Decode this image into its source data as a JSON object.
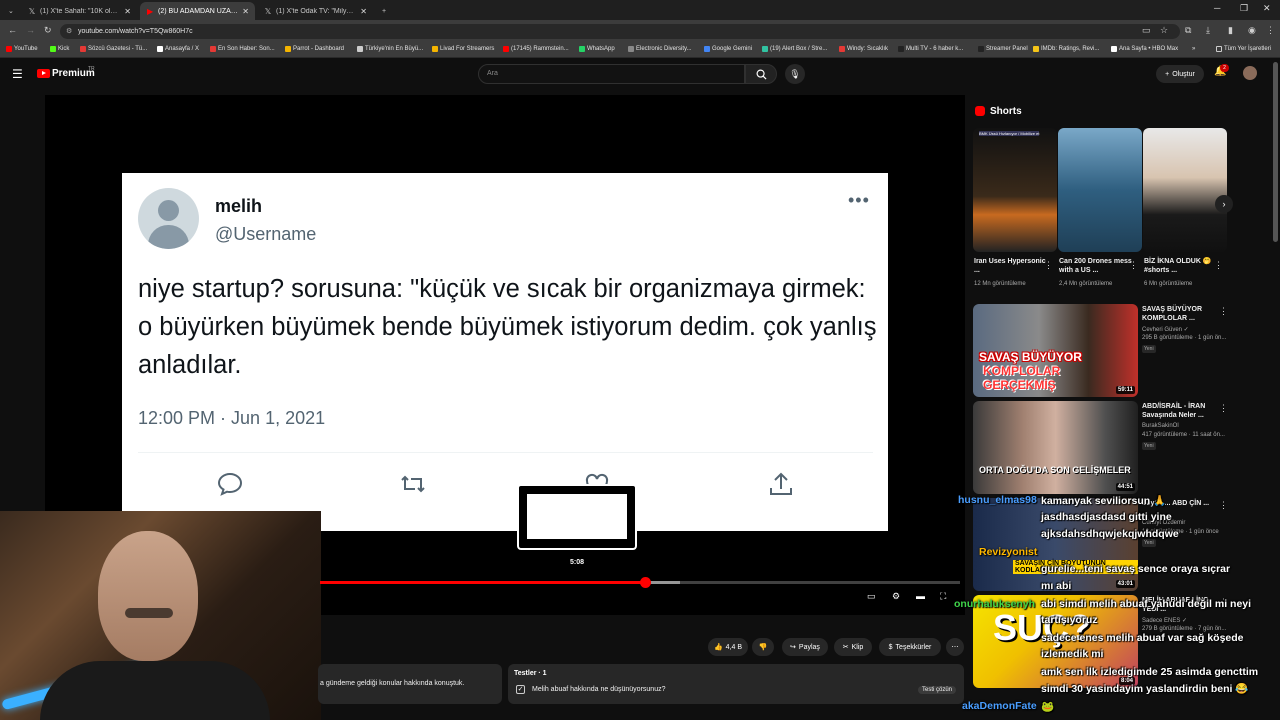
{
  "browser": {
    "tabs": [
      {
        "label": "(1) X'te Sahafi: \"10K olmuşuz. Bu...",
        "active": false
      },
      {
        "label": "(2) BU ADAMDAN UZAK DURUN",
        "active": true
      },
      {
        "label": "(1) X'te Odak TV: \"Milyonlarca (...",
        "active": false
      }
    ],
    "new_tab": "+",
    "url": "youtube.com/watch?v=T5Qw860H7c",
    "bookmarks": [
      {
        "label": "YouTube",
        "color": "#ff0000"
      },
      {
        "label": "Kick",
        "color": "#53fc18"
      },
      {
        "label": "Sözcü Gazetesi - Tü...",
        "color": "#e53935"
      },
      {
        "label": "Anasayfa / X",
        "color": "#ffffff"
      },
      {
        "label": "En Son Haber: Son...",
        "color": "#e53935"
      },
      {
        "label": "Parrot - Dashboard",
        "color": "#f4b400"
      },
      {
        "label": "Türkiye'nin En Büyü...",
        "color": "#cccccc"
      },
      {
        "label": "Livad For Streamers",
        "color": "#f4b400"
      },
      {
        "label": "(17145) Rammstein...",
        "color": "#ff0000"
      },
      {
        "label": "WhatsApp",
        "color": "#25d366"
      },
      {
        "label": "Electronic Diversity...",
        "color": "#888888"
      },
      {
        "label": "Google Gemini",
        "color": "#4285f4"
      },
      {
        "label": "(19) Alert Box / Stre...",
        "color": "#31c3a2"
      },
      {
        "label": "Windy: Sıcaklık",
        "color": "#e53935"
      },
      {
        "label": "Multi TV - 6 haber k...",
        "color": "#222222"
      },
      {
        "label": "Streamer Panel",
        "color": "#222222"
      },
      {
        "label": "IMDb: Ratings, Revi...",
        "color": "#f5c518"
      },
      {
        "label": "Ana Sayfa • HBO Max",
        "color": "#ffffff"
      }
    ],
    "all_bookmarks": "Tüm Yer İşaretleri"
  },
  "youtube": {
    "logo_text": "Premium",
    "logo_region": "TR",
    "search_placeholder": "Ara",
    "create_label": "Oluştur",
    "notification_count": "2"
  },
  "tweet": {
    "name": "melih",
    "handle": "@Username",
    "text": "niye startup? sorusuna: \"küçük ve sıcak bir organizmaya girmek: o büyürken büyümek bende büyümek istiyorum dedim. çok yanlış anladılar.",
    "time": "12:00 PM · Jun 1, 2021"
  },
  "player": {
    "preview_time": "5:08",
    "progress_played": 0.508,
    "progress_buffered": 0.5625
  },
  "actions": {
    "likes": "4,4 B",
    "share": "Paylaş",
    "clip": "Klip",
    "thanks": "Teşekkürler"
  },
  "description_snippet": "a gündeme geldiği konular hakkında konuştuk.",
  "quiz": {
    "title": "Testler",
    "count": "1",
    "question": "Melih abuaf hakkında ne düşünüyorsunuz?",
    "solve": "Testi çözün"
  },
  "sidebar": {
    "shorts_title": "Shorts",
    "shorts": [
      {
        "title": "Iran Uses Hypersonic ...",
        "views": "12 Mn görüntüleme",
        "overlay": "BMK Üssü Hızlanıyor / Mobilize et"
      },
      {
        "title": "Can 200 Drones mess with a US ...",
        "views": "2,4 Mn görüntüleme"
      },
      {
        "title": "BİZ İKNA OLDUK 🤭 #shorts ...",
        "views": "6 Mn görüntüleme"
      }
    ],
    "videos": [
      {
        "title": "SAVAŞ BÜYÜYOR KOMPLOLAR ...",
        "channel": "Cevheri Güven ✓",
        "meta": "295 B görüntüleme · 1 gün ön...",
        "badge": "Yeni",
        "duration": "59:11",
        "overlay1": "SAVAŞ BÜYÜYOR",
        "overlay2": "KOMPLOLAR",
        "overlay3": "GERÇEKMİŞ"
      },
      {
        "title": "ABD/İSRAİL - İRAN Savaşında Neler ...",
        "channel": "BurakSakinOl",
        "meta": "417 görüntüleme · 11 saat ön...",
        "badge": "Yeni",
        "duration": "44:51",
        "overlay1": "ORTA DOĞU'DA SON GELİŞMELER"
      },
      {
        "title": "büyük ... ABD ÇİN ...",
        "channel": "Cüneyt Özdemir",
        "meta": "12 görüntüleme · 1 gün önce",
        "badge": "Yeni",
        "duration": "43:01",
        "overlay1": "SAVAŞIN ÇİN BOYUTUNUN KODLARI"
      },
      {
        "title": "MELİH ABUAF LİNÇ YEDİ ...",
        "channel": "Sadece ENES ✓",
        "meta": "279 B görüntüleme · 7 gün ön...",
        "duration": "8:04",
        "overlay1": "SUÇ?"
      }
    ]
  },
  "chat": [
    {
      "user": "husnu_elmas98",
      "user_color": "#4a9eff",
      "text": "kamanyak seviliorsun 🙏 "
    },
    {
      "user": "",
      "user_color": "#9966ff",
      "text": "jasdhasdjasdasd gitti yine"
    },
    {
      "user": "",
      "user_color": "#9966ff",
      "text": "ajksdahsdhqwjekqjwhdqwe"
    },
    {
      "user": "Revizyonist",
      "user_color": "#ffb800",
      "text": ""
    },
    {
      "user": "",
      "user_color": "#4a9eff",
      "text": "gurelie...teni savaş sence oraya sıçrar"
    },
    {
      "user": "",
      "user_color": "#fff",
      "text": "mı abi"
    },
    {
      "user": "onurhaluksenyh",
      "user_color": "#3fd44a",
      "text": "abi simdi melih abuaf yahudi değil mi neyi"
    },
    {
      "user": "",
      "user_color": "#fff",
      "text": "tartışıyoruz"
    },
    {
      "user": "",
      "user_color": "#ff7b7b",
      "text": "sadece enes melih abuaf var sağ köşede"
    },
    {
      "user": "",
      "user_color": "#fff",
      "text": "izlemedik mi"
    },
    {
      "user": "",
      "user_color": "#ff7b7b",
      "text": "amk sen ilk izledigimde 25 asimda gencttim"
    },
    {
      "user": "",
      "user_color": "#fff",
      "text": "simdi 30 yasindayim yaslandirdin beni 😂"
    },
    {
      "user": "akaDemonFate",
      "user_color": "#4a9eff",
      "text": "🐸"
    }
  ]
}
